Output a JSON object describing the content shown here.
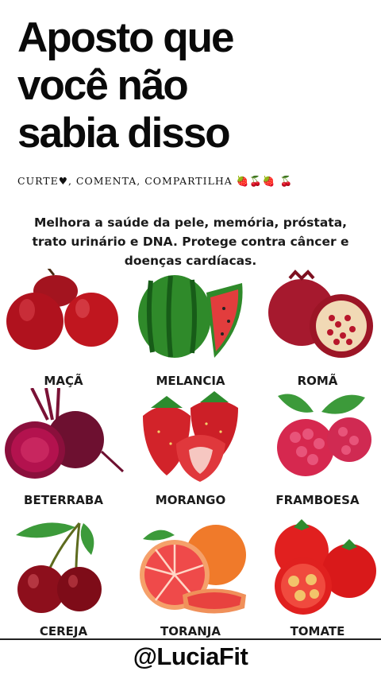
{
  "headline": [
    "Aposto que",
    "você não",
    "sabia disso"
  ],
  "social": {
    "text": "CURTE♥, COMENTA, COMPARTILHA",
    "emoji": "🍓🍒🍓 🍒"
  },
  "intro": "Melhora a saúde da pele, memória, próstata, trato urinário e DNA. Protege contra câncer e doenças cardíacas.",
  "fruits": [
    {
      "label": "MAÇÃ",
      "icon": "apple-icon"
    },
    {
      "label": "MELANCIA",
      "icon": "watermelon-icon"
    },
    {
      "label": "ROMÃ",
      "icon": "pomegranate-icon"
    },
    {
      "label": "BETERRABA",
      "icon": "beet-icon"
    },
    {
      "label": "MORANGO",
      "icon": "strawberry-icon"
    },
    {
      "label": "FRAMBOESA",
      "icon": "raspberry-icon"
    },
    {
      "label": "CEREJA",
      "icon": "cherry-icon"
    },
    {
      "label": "TORANJA",
      "icon": "grapefruit-icon"
    },
    {
      "label": "TOMATE",
      "icon": "tomato-icon"
    }
  ],
  "handle": "@LuciaFit",
  "colors": {
    "red": "#c8102e",
    "green": "#2e8b2e",
    "text": "#111111"
  }
}
